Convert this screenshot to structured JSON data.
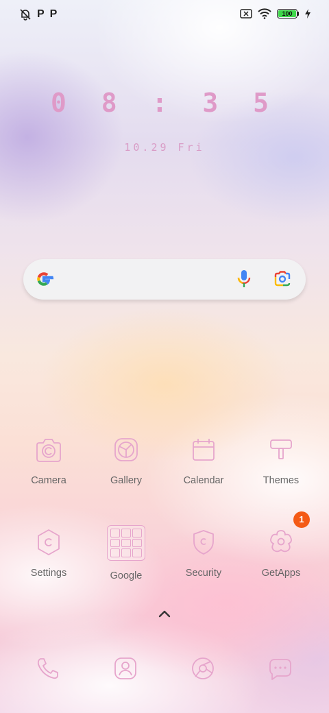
{
  "status_bar": {
    "left_icons": [
      "notifications-off-icon",
      "p-icon",
      "p-icon"
    ],
    "p_label": "P",
    "right_icons": [
      "sim-off-icon",
      "wifi-icon",
      "battery-icon",
      "charging-icon"
    ],
    "battery_level": "100"
  },
  "clock": {
    "time": "0 8 : 3 5",
    "date": "10.29 Fri"
  },
  "search": {
    "icons": [
      "google-logo-icon",
      "microphone-icon",
      "google-lens-icon"
    ]
  },
  "apps": [
    {
      "label": "Camera",
      "icon": "camera-icon"
    },
    {
      "label": "Gallery",
      "icon": "gallery-icon"
    },
    {
      "label": "Calendar",
      "icon": "calendar-icon"
    },
    {
      "label": "Themes",
      "icon": "themes-icon"
    },
    {
      "label": "Settings",
      "icon": "settings-icon"
    },
    {
      "label": "Google",
      "icon": "google-folder-icon"
    },
    {
      "label": "Security",
      "icon": "security-icon"
    },
    {
      "label": "GetApps",
      "icon": "getapps-icon",
      "badge": "1"
    }
  ],
  "dock": [
    {
      "icon": "phone-icon"
    },
    {
      "icon": "contacts-icon"
    },
    {
      "icon": "browser-icon"
    },
    {
      "icon": "messages-icon"
    }
  ],
  "colors": {
    "icon_stroke": "#e6a5cc",
    "clock": "#df9ac8",
    "badge": "#f45a16",
    "battery_fill": "#3fd84b"
  }
}
